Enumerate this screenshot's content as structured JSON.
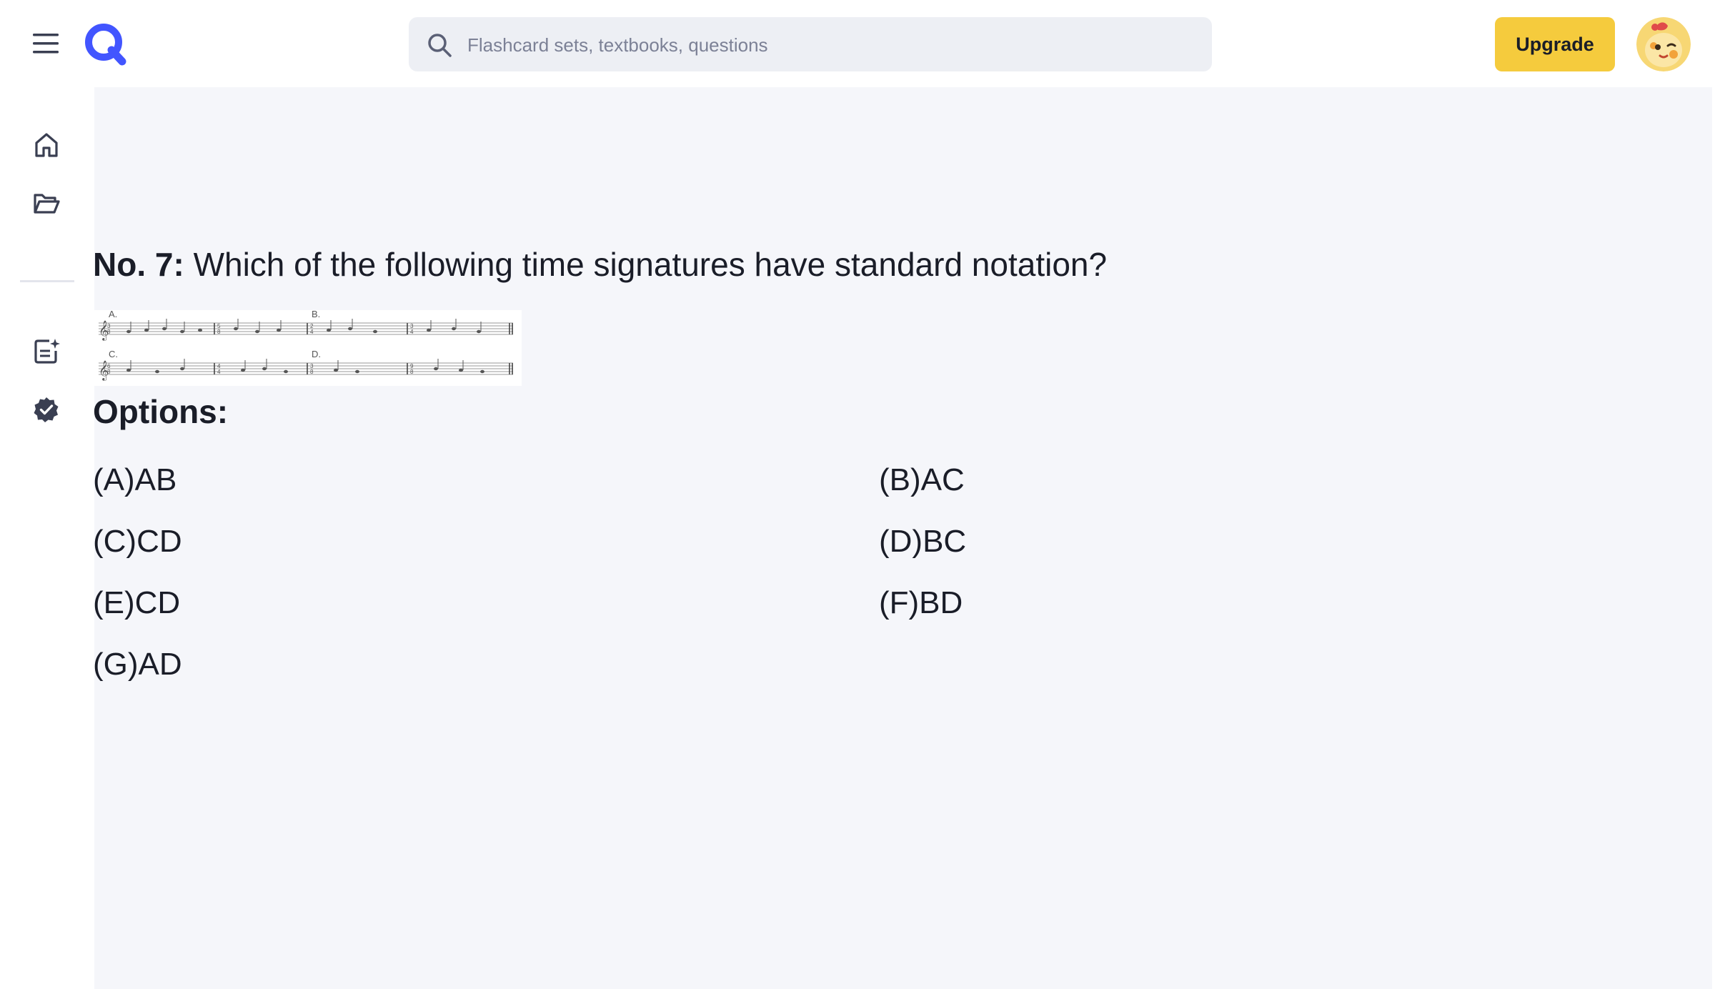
{
  "header": {
    "search_placeholder": "Flashcard sets, textbooks, questions",
    "upgrade_label": "Upgrade",
    "brand_color": "#4255ff",
    "upgrade_color": "#f5cb3d"
  },
  "sidebar": {
    "items": [
      {
        "icon": "home-icon"
      },
      {
        "icon": "folder-open-icon"
      },
      {
        "icon": "notes-sparkle-icon"
      },
      {
        "icon": "verified-badge-icon"
      }
    ]
  },
  "question": {
    "number_label": "No. 7:",
    "text": "Which of the following time signatures have standard notation?",
    "score_labels": [
      "A.",
      "B.",
      "C.",
      "D."
    ]
  },
  "options_heading": "Options:",
  "options": [
    {
      "label": "(A)AB"
    },
    {
      "label": "(B)AC"
    },
    {
      "label": "(C)CD"
    },
    {
      "label": "(D)BC"
    },
    {
      "label": "(E)CD"
    },
    {
      "label": "(F)BD"
    },
    {
      "label": "(G)AD"
    }
  ]
}
